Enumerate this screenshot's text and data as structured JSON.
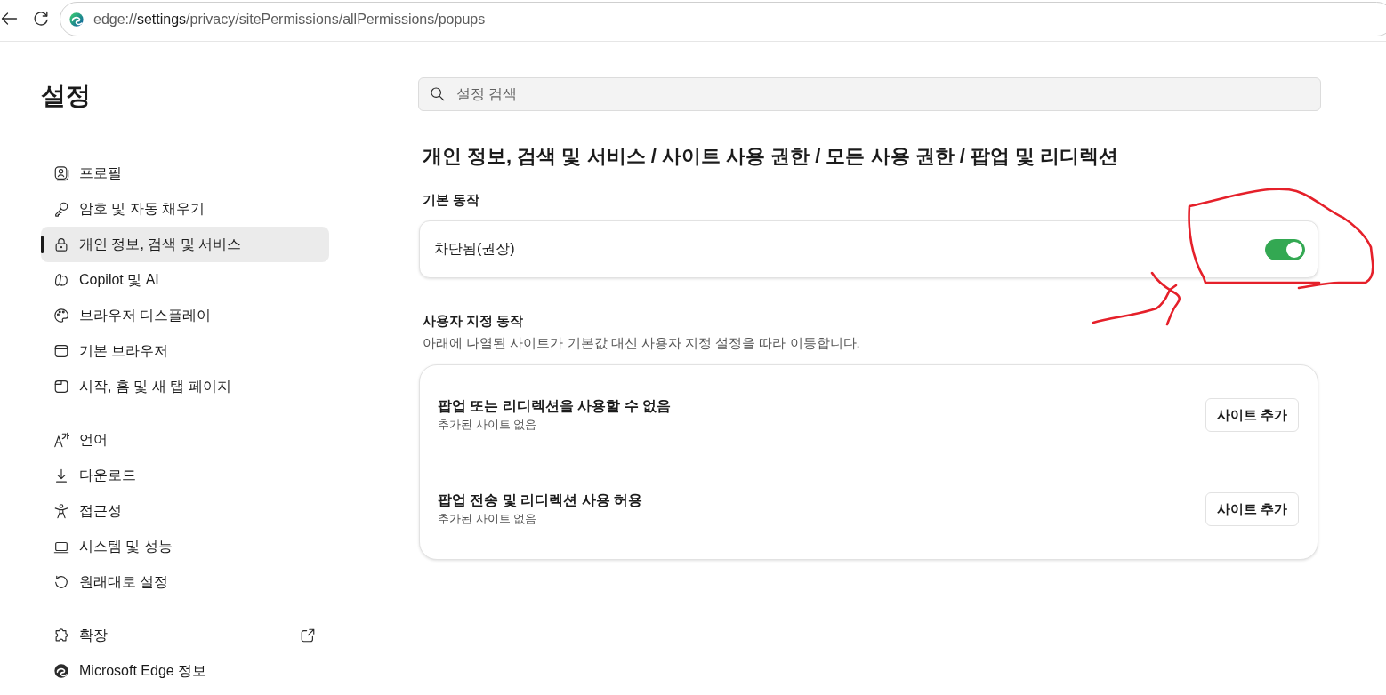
{
  "browser": {
    "url": {
      "scheme": "edge://",
      "host": "settings",
      "path": "/privacy/sitePermissions/allPermissions/popups"
    }
  },
  "sidebar": {
    "title": "설정",
    "groups": [
      {
        "items": [
          {
            "label": "프로필",
            "selected": false,
            "external": false
          },
          {
            "label": "암호 및 자동 채우기",
            "selected": false,
            "external": false
          },
          {
            "label": "개인 정보, 검색 및 서비스",
            "selected": true,
            "external": false
          },
          {
            "label": "Copilot 및 AI",
            "selected": false,
            "external": false
          },
          {
            "label": "브라우저 디스플레이",
            "selected": false,
            "external": false
          },
          {
            "label": "기본 브라우저",
            "selected": false,
            "external": false
          },
          {
            "label": "시작, 홈 및 새 탭 페이지",
            "selected": false,
            "external": false
          }
        ]
      },
      {
        "items": [
          {
            "label": "언어",
            "selected": false,
            "external": false
          },
          {
            "label": "다운로드",
            "selected": false,
            "external": false
          },
          {
            "label": "접근성",
            "selected": false,
            "external": false
          },
          {
            "label": "시스템 및 성능",
            "selected": false,
            "external": false
          },
          {
            "label": "원래대로 설정",
            "selected": false,
            "external": false
          }
        ]
      },
      {
        "items": [
          {
            "label": "확장",
            "selected": false,
            "external": true
          },
          {
            "label": "Microsoft Edge 정보",
            "selected": false,
            "external": false
          }
        ]
      }
    ]
  },
  "search": {
    "placeholder": "설정 검색"
  },
  "page_title": "개인 정보, 검색 및 서비스 / 사이트 사용 권한 / 모든 사용 권한 / 팝업 및 리디렉션",
  "default_behavior": {
    "heading": "기본 동작",
    "label": "차단됨(권장)",
    "on": true
  },
  "custom_behaviors": {
    "heading": "사용자 지정 동작",
    "description": "아래에 나열된 사이트가 기본값 대신 사용자 지정 설정을 따라 이동합니다.",
    "rows": [
      {
        "title": "팝업 또는 리디렉션을 사용할 수 없음",
        "subtitle": "추가된 사이트 없음",
        "button": "사이트 추가"
      },
      {
        "title": "팝업 전송 및 리디렉션 사용 허용",
        "subtitle": "추가된 사이트 없음",
        "button": "사이트 추가"
      }
    ]
  },
  "hand_marks": {
    "loop": true,
    "arrow": true
  }
}
